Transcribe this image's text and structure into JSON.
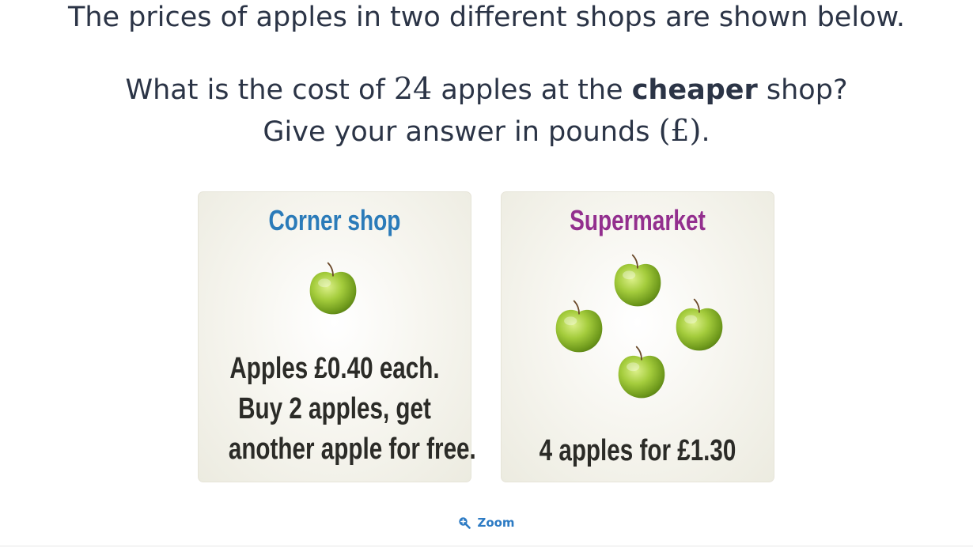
{
  "question": {
    "intro": "The prices of apples in two different shops are shown below.",
    "prompt_before": "What is the cost of ",
    "prompt_number": "24",
    "prompt_middle": " apples at the ",
    "prompt_bold": "cheaper",
    "prompt_after": " shop?",
    "instruction_before": "Give your answer in pounds ",
    "instruction_math": "(£)",
    "instruction_after": "."
  },
  "shops": {
    "corner": {
      "title": "Corner shop",
      "title_color": "#2b7bb9",
      "line1": "Apples £0.40 each.",
      "line2": "Buy 2 apples, get",
      "line3": "another apple for free."
    },
    "supermarket": {
      "title": "Supermarket",
      "title_color": "#932f8e",
      "offer": "4 apples for £1.30"
    }
  },
  "zoom": {
    "label": "Zoom",
    "icon": "zoom-in-icon"
  }
}
